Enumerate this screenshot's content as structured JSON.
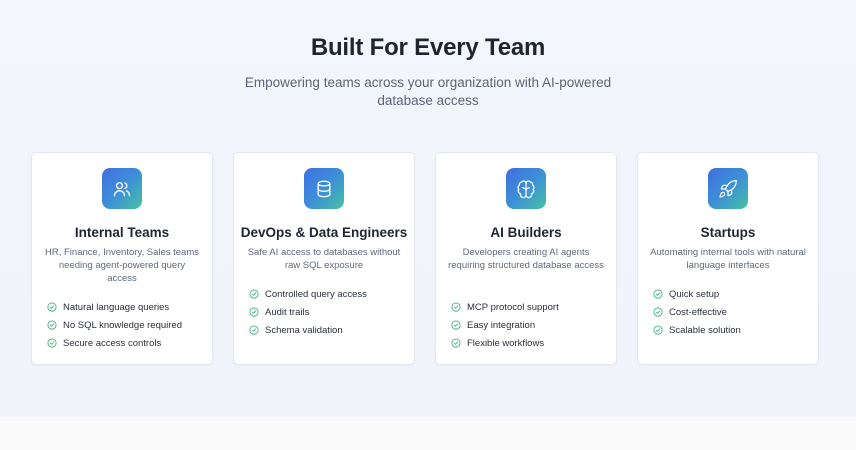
{
  "section": {
    "title": "Built For Every Team",
    "subtitle": "Empowering teams across your organization with AI-powered database access"
  },
  "colors": {
    "icon_gradient_start": "#3f6fe0",
    "icon_gradient_end": "#46c2a0",
    "check": "#3bb37a"
  },
  "cards": [
    {
      "icon": "users-icon",
      "title": "Internal Teams",
      "description": "HR, Finance, Inventory, Sales teams needing agent-powered query access",
      "features": [
        "Natural language queries",
        "No SQL knowledge required",
        "Secure access controls"
      ]
    },
    {
      "icon": "database-icon",
      "title": "DevOps & Data Engineers",
      "description": "Safe AI access to databases without raw SQL exposure",
      "features": [
        "Controlled query access",
        "Audit trails",
        "Schema validation"
      ]
    },
    {
      "icon": "brain-icon",
      "title": "AI Builders",
      "description": "Developers creating AI agents requiring structured database access",
      "features": [
        "MCP protocol support",
        "Easy integration",
        "Flexible workflows"
      ]
    },
    {
      "icon": "rocket-icon",
      "title": "Startups",
      "description": "Automating internal tools with natural language interfaces",
      "features": [
        "Quick setup",
        "Cost-effective",
        "Scalable solution"
      ]
    }
  ]
}
